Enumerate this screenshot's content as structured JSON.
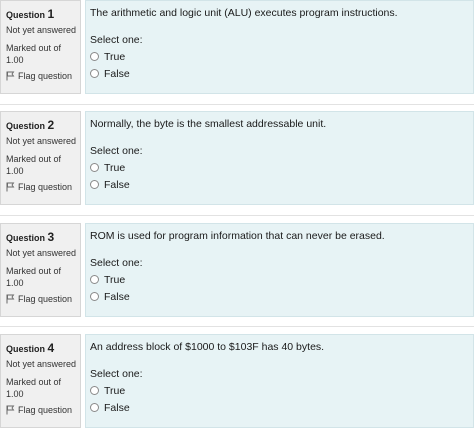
{
  "questions": [
    {
      "label": "Question",
      "number": "1",
      "state": "Not yet answered",
      "grade_line1": "Marked out of",
      "grade_line2": "1.00",
      "flag": "Flag question",
      "text": "The arithmetic and logic unit (ALU) executes program instructions.",
      "prompt": "Select one:",
      "options": [
        "True",
        "False"
      ]
    },
    {
      "label": "Question",
      "number": "2",
      "state": "Not yet answered",
      "grade_line1": "Marked out of",
      "grade_line2": "1.00",
      "flag": "Flag question",
      "text": "Normally, the byte is the smallest addressable unit.",
      "prompt": "Select one:",
      "options": [
        "True",
        "False"
      ]
    },
    {
      "label": "Question",
      "number": "3",
      "state": "Not yet answered",
      "grade_line1": "Marked out of",
      "grade_line2": "1.00",
      "flag": "Flag question",
      "text": "ROM is used for program information that can never be erased.",
      "prompt": "Select one:",
      "options": [
        "True",
        "False"
      ]
    },
    {
      "label": "Question",
      "number": "4",
      "state": "Not yet answered",
      "grade_line1": "Marked out of",
      "grade_line2": "1.00",
      "flag": "Flag question",
      "text": "An address block of $1000 to $103F has 40 bytes.",
      "prompt": "Select one:",
      "options": [
        "True",
        "False"
      ]
    }
  ],
  "icons": {
    "flag": "flag-icon",
    "radio": "radio-button-icon"
  },
  "colors": {
    "content_bg": "#e7f3f5",
    "info_bg": "#f0f0f0"
  }
}
